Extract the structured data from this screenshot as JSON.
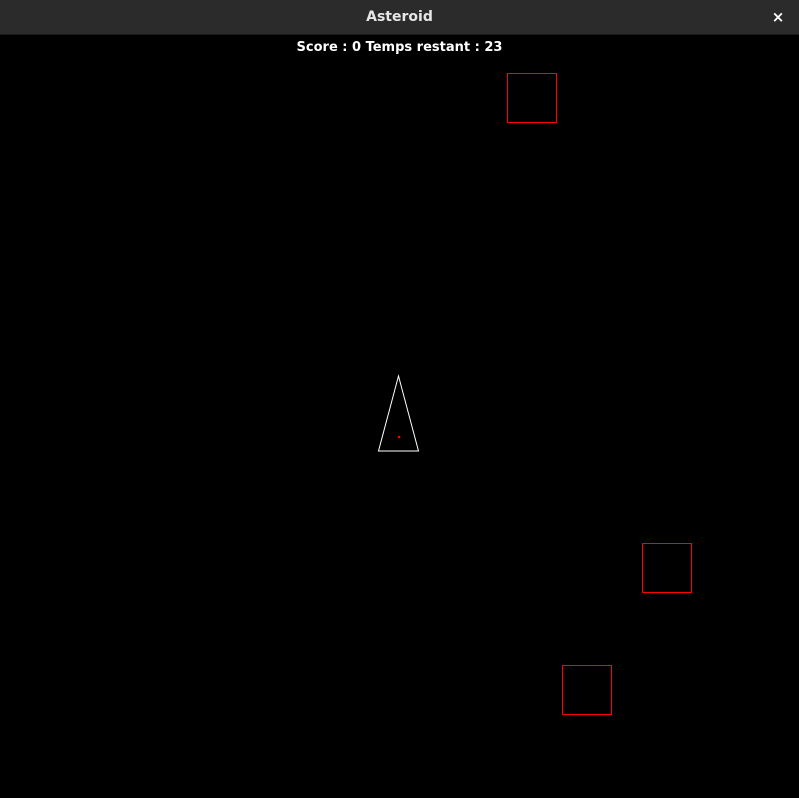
{
  "window": {
    "title": "Asteroid",
    "close_glyph": "×"
  },
  "hud": {
    "score_label": "Score",
    "score": 0,
    "time_label": "Temps restant",
    "time_remaining": 23,
    "text": "Score : 0 Temps restant : 23"
  },
  "colors": {
    "background": "#000000",
    "titlebar": "#2b2b2b",
    "asteroid_outline": "#ff0000",
    "ship_outline": "#ffffff",
    "ship_core": "#ff0000",
    "hud_text": "#ffffff"
  },
  "icons": {
    "close": "close-icon"
  }
}
